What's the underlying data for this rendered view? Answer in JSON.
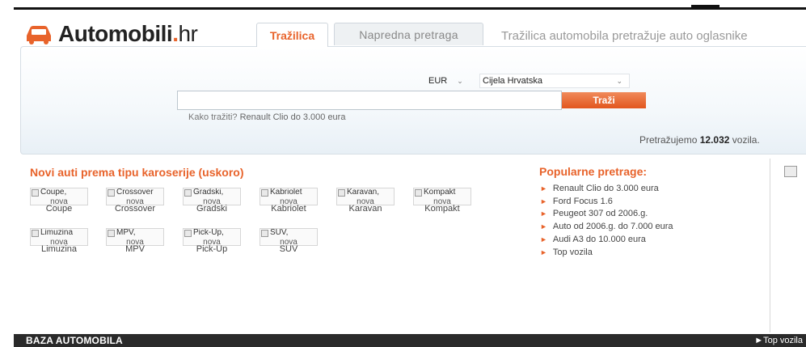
{
  "brand": {
    "name": "Automobili",
    "dot": ".",
    "suffix": "hr",
    "accent": "#e8632b",
    "logo_icon": "car-icon"
  },
  "tabs": [
    {
      "label": "Tražilica",
      "active": true
    },
    {
      "label": "Napredna pretraga",
      "active": false
    }
  ],
  "tagline": "Tražilica automobila pretražuje auto oglasnike",
  "search": {
    "currency": "EUR",
    "region": "Cijela Hrvatska",
    "input_value": "",
    "button_label": "Traži",
    "hint_prefix": "Kako tražiti?",
    "hint_example": "Renault Clio do 3.000 eura",
    "count_prefix": "Pretražujemo",
    "count_value": "12.032",
    "count_suffix": "vozila."
  },
  "categories": {
    "title": "Novi auti prema tipu karoserije (uskoro)",
    "items": [
      {
        "alt": "Coupe,",
        "nova": "nova",
        "label": "Coupe"
      },
      {
        "alt": "Crossover",
        "nova": "nova",
        "label": "Crossover"
      },
      {
        "alt": "Gradski,",
        "nova": "nova",
        "label": "Gradski"
      },
      {
        "alt": "Kabriolet",
        "nova": "nova",
        "label": "Kabriolet"
      },
      {
        "alt": "Karavan,",
        "nova": "nova",
        "label": "Karavan"
      },
      {
        "alt": "Kompakt",
        "nova": "nova",
        "label": "Kompakt"
      },
      {
        "alt": "Limuzina",
        "nova": "nova",
        "label": "Limuzina"
      },
      {
        "alt": "MPV,",
        "nova": "nova",
        "label": "MPV"
      },
      {
        "alt": "Pick-Up,",
        "nova": "nova",
        "label": "Pick-Up"
      },
      {
        "alt": "SUV,",
        "nova": "nova",
        "label": "SUV"
      }
    ]
  },
  "popular": {
    "title": "Popularne pretrage:",
    "items": [
      "Renault Clio do 3.000 eura",
      "Ford Focus 1.6",
      "Peugeot 307 od 2006.g.",
      "Auto od 2006.g. do 7.000 eura",
      "Audi A3 do 10.000 eura",
      "Top vozila"
    ]
  },
  "bottom": {
    "title": "BAZA AUTOMOBILA",
    "link": "►Top vozila"
  }
}
